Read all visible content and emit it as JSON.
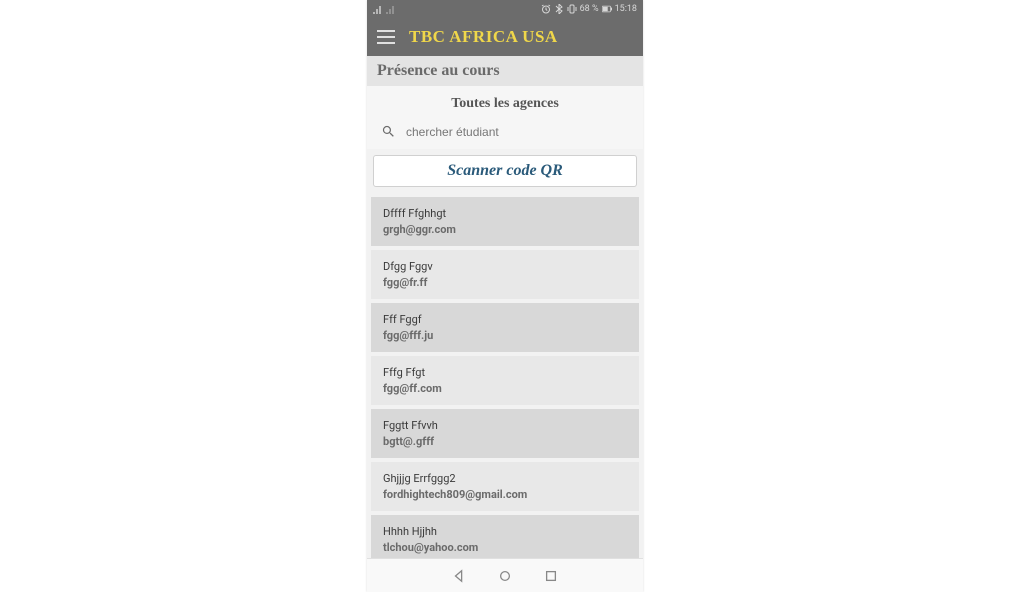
{
  "statusbar": {
    "battery_text": "68 %",
    "time": "15:18"
  },
  "appbar": {
    "title": "TBC AFRICA USA"
  },
  "subheader": "Présence au cours",
  "agencies_label": "Toutes les agences",
  "search": {
    "placeholder": "chercher étudiant"
  },
  "qr_button": "Scanner code QR",
  "students": [
    {
      "name": "Dffff Ffghhgt",
      "email": "grgh@ggr.com"
    },
    {
      "name": "Dfgg Fggv",
      "email": "fgg@fr.ff"
    },
    {
      "name": "Fff Fggf",
      "email": "fgg@fff.ju"
    },
    {
      "name": "Fffg Ffgt",
      "email": "fgg@ff.com"
    },
    {
      "name": "Fggtt Ffvvh",
      "email": "bgtt@.gfff"
    },
    {
      "name": "Ghjjjg Errfggg2",
      "email": "fordhightech809@gmail.com"
    },
    {
      "name": "Hhhh Hjjhh",
      "email": "tlchou@yahoo.com"
    }
  ]
}
